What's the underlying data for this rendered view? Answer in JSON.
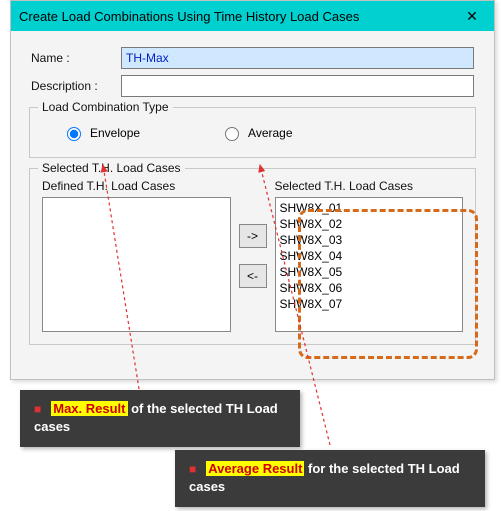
{
  "dialog": {
    "title": "Create Load Combinations Using Time History Load Cases",
    "close": "✕",
    "name_label": "Name  :",
    "name_value": "TH-Max",
    "desc_label": "Description :",
    "desc_value": "",
    "combo_group": "Load Combination Type",
    "radio_envelope": "Envelope",
    "radio_average": "Average",
    "selected_group": "Selected T.H. Load Cases",
    "defined_list_label": "Defined T.H. Load Cases",
    "selected_list_label": "Selected T.H. Load Cases",
    "arrow_right": "->",
    "arrow_left": "<-",
    "selected_items": [
      "SHW8X_01",
      "SHW8X_02",
      "SHW8X_03",
      "SHW8X_04",
      "SHW8X_05",
      "SHW8X_06",
      "SHW8X_07"
    ]
  },
  "callouts": {
    "c1_hl": "Max. Result",
    "c1_rest": " of the selected TH Load cases",
    "c2_hl": "Average Result",
    "c2_rest": " for the selected TH Load cases"
  }
}
